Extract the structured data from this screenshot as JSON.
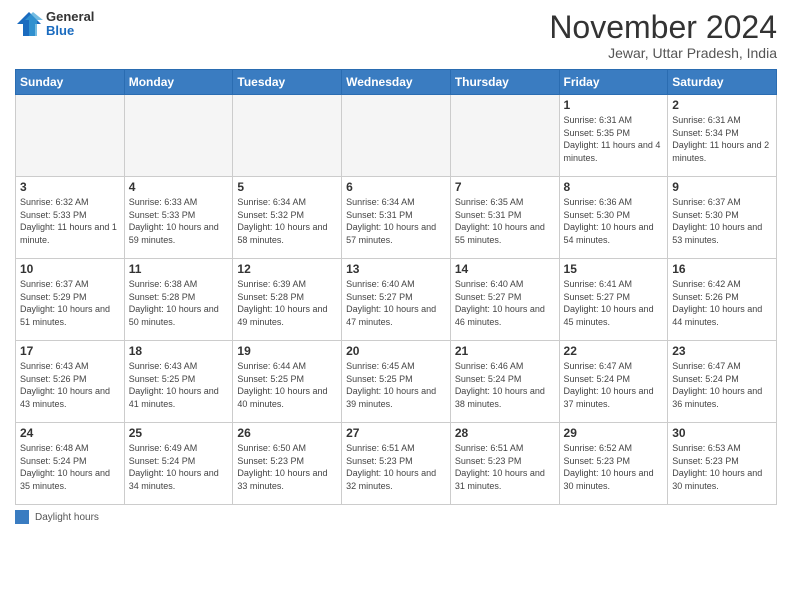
{
  "logo": {
    "general": "General",
    "blue": "Blue"
  },
  "title": "November 2024",
  "location": "Jewar, Uttar Pradesh, India",
  "weekdays": [
    "Sunday",
    "Monday",
    "Tuesday",
    "Wednesday",
    "Thursday",
    "Friday",
    "Saturday"
  ],
  "legend_label": "Daylight hours",
  "weeks": [
    [
      {
        "day": "",
        "info": ""
      },
      {
        "day": "",
        "info": ""
      },
      {
        "day": "",
        "info": ""
      },
      {
        "day": "",
        "info": ""
      },
      {
        "day": "",
        "info": ""
      },
      {
        "day": "1",
        "info": "Sunrise: 6:31 AM\nSunset: 5:35 PM\nDaylight: 11 hours and 4 minutes."
      },
      {
        "day": "2",
        "info": "Sunrise: 6:31 AM\nSunset: 5:34 PM\nDaylight: 11 hours and 2 minutes."
      }
    ],
    [
      {
        "day": "3",
        "info": "Sunrise: 6:32 AM\nSunset: 5:33 PM\nDaylight: 11 hours and 1 minute."
      },
      {
        "day": "4",
        "info": "Sunrise: 6:33 AM\nSunset: 5:33 PM\nDaylight: 10 hours and 59 minutes."
      },
      {
        "day": "5",
        "info": "Sunrise: 6:34 AM\nSunset: 5:32 PM\nDaylight: 10 hours and 58 minutes."
      },
      {
        "day": "6",
        "info": "Sunrise: 6:34 AM\nSunset: 5:31 PM\nDaylight: 10 hours and 57 minutes."
      },
      {
        "day": "7",
        "info": "Sunrise: 6:35 AM\nSunset: 5:31 PM\nDaylight: 10 hours and 55 minutes."
      },
      {
        "day": "8",
        "info": "Sunrise: 6:36 AM\nSunset: 5:30 PM\nDaylight: 10 hours and 54 minutes."
      },
      {
        "day": "9",
        "info": "Sunrise: 6:37 AM\nSunset: 5:30 PM\nDaylight: 10 hours and 53 minutes."
      }
    ],
    [
      {
        "day": "10",
        "info": "Sunrise: 6:37 AM\nSunset: 5:29 PM\nDaylight: 10 hours and 51 minutes."
      },
      {
        "day": "11",
        "info": "Sunrise: 6:38 AM\nSunset: 5:28 PM\nDaylight: 10 hours and 50 minutes."
      },
      {
        "day": "12",
        "info": "Sunrise: 6:39 AM\nSunset: 5:28 PM\nDaylight: 10 hours and 49 minutes."
      },
      {
        "day": "13",
        "info": "Sunrise: 6:40 AM\nSunset: 5:27 PM\nDaylight: 10 hours and 47 minutes."
      },
      {
        "day": "14",
        "info": "Sunrise: 6:40 AM\nSunset: 5:27 PM\nDaylight: 10 hours and 46 minutes."
      },
      {
        "day": "15",
        "info": "Sunrise: 6:41 AM\nSunset: 5:27 PM\nDaylight: 10 hours and 45 minutes."
      },
      {
        "day": "16",
        "info": "Sunrise: 6:42 AM\nSunset: 5:26 PM\nDaylight: 10 hours and 44 minutes."
      }
    ],
    [
      {
        "day": "17",
        "info": "Sunrise: 6:43 AM\nSunset: 5:26 PM\nDaylight: 10 hours and 43 minutes."
      },
      {
        "day": "18",
        "info": "Sunrise: 6:43 AM\nSunset: 5:25 PM\nDaylight: 10 hours and 41 minutes."
      },
      {
        "day": "19",
        "info": "Sunrise: 6:44 AM\nSunset: 5:25 PM\nDaylight: 10 hours and 40 minutes."
      },
      {
        "day": "20",
        "info": "Sunrise: 6:45 AM\nSunset: 5:25 PM\nDaylight: 10 hours and 39 minutes."
      },
      {
        "day": "21",
        "info": "Sunrise: 6:46 AM\nSunset: 5:24 PM\nDaylight: 10 hours and 38 minutes."
      },
      {
        "day": "22",
        "info": "Sunrise: 6:47 AM\nSunset: 5:24 PM\nDaylight: 10 hours and 37 minutes."
      },
      {
        "day": "23",
        "info": "Sunrise: 6:47 AM\nSunset: 5:24 PM\nDaylight: 10 hours and 36 minutes."
      }
    ],
    [
      {
        "day": "24",
        "info": "Sunrise: 6:48 AM\nSunset: 5:24 PM\nDaylight: 10 hours and 35 minutes."
      },
      {
        "day": "25",
        "info": "Sunrise: 6:49 AM\nSunset: 5:24 PM\nDaylight: 10 hours and 34 minutes."
      },
      {
        "day": "26",
        "info": "Sunrise: 6:50 AM\nSunset: 5:23 PM\nDaylight: 10 hours and 33 minutes."
      },
      {
        "day": "27",
        "info": "Sunrise: 6:51 AM\nSunset: 5:23 PM\nDaylight: 10 hours and 32 minutes."
      },
      {
        "day": "28",
        "info": "Sunrise: 6:51 AM\nSunset: 5:23 PM\nDaylight: 10 hours and 31 minutes."
      },
      {
        "day": "29",
        "info": "Sunrise: 6:52 AM\nSunset: 5:23 PM\nDaylight: 10 hours and 30 minutes."
      },
      {
        "day": "30",
        "info": "Sunrise: 6:53 AM\nSunset: 5:23 PM\nDaylight: 10 hours and 30 minutes."
      }
    ]
  ]
}
